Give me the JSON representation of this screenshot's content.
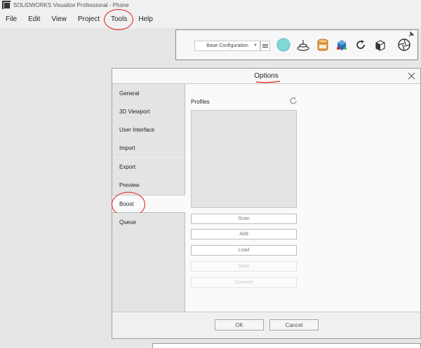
{
  "window": {
    "title": "SOLIDWORKS Visualize Professional - Phone"
  },
  "menu": [
    {
      "label": "File"
    },
    {
      "label": "Edit"
    },
    {
      "label": "View"
    },
    {
      "label": "Project"
    },
    {
      "label": "Tools"
    },
    {
      "label": "Help"
    }
  ],
  "toolbar": {
    "configuration": "Base Configuration",
    "icons": [
      "appearance-icon",
      "scene-icon",
      "camera-icon",
      "product-icon",
      "refresh-icon",
      "cube-icon",
      "render-icon"
    ]
  },
  "dialog": {
    "title": "Options",
    "nav": [
      {
        "label": "General"
      },
      {
        "label": "3D Viewport"
      },
      {
        "label": "User Interface"
      },
      {
        "label": "Import"
      },
      {
        "label": "Export"
      },
      {
        "label": "Preview"
      },
      {
        "label": "Boost"
      },
      {
        "label": "Queue"
      }
    ],
    "active_nav": "Boost",
    "content": {
      "profiles_label": "Profiles",
      "buttons": [
        {
          "label": "Scan",
          "enabled": true
        },
        {
          "label": "Add",
          "enabled": true
        },
        {
          "label": "Load",
          "enabled": true
        },
        {
          "label": "Save",
          "enabled": false
        },
        {
          "label": "Connect",
          "enabled": false
        }
      ]
    },
    "footer": {
      "ok": "OK",
      "cancel": "Cancel"
    }
  },
  "colors": {
    "annotation": "#e02020",
    "appearance": "#7fd8d8",
    "camera": "#e8a040",
    "product": "#2a6fb8"
  }
}
